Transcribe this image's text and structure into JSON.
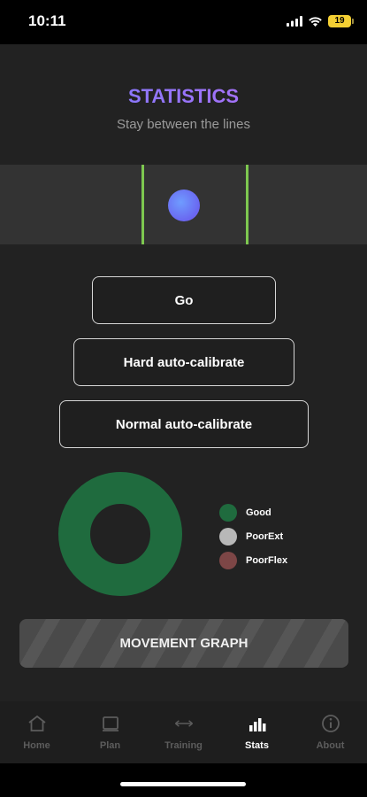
{
  "status_bar": {
    "time": "10:11",
    "battery": "19"
  },
  "header": {
    "title": "STATISTICS",
    "subtitle": "Stay between the lines"
  },
  "buttons": {
    "go": "Go",
    "hard_calibrate": "Hard auto-calibrate",
    "normal_calibrate": "Normal auto-calibrate"
  },
  "chart_data": {
    "type": "pie",
    "categories": [
      "Good",
      "PoorExt",
      "PoorFlex"
    ],
    "values": [
      100,
      0,
      0
    ],
    "colors": [
      "#1f6b3e",
      "#b8b8b8",
      "#7d4646"
    ]
  },
  "graph_button": "MOVEMENT GRAPH",
  "tabs": [
    {
      "label": "Home",
      "icon": "home-icon"
    },
    {
      "label": "Plan",
      "icon": "plan-icon"
    },
    {
      "label": "Training",
      "icon": "training-icon"
    },
    {
      "label": "Stats",
      "icon": "stats-icon",
      "active": true
    },
    {
      "label": "About",
      "icon": "about-icon"
    }
  ]
}
